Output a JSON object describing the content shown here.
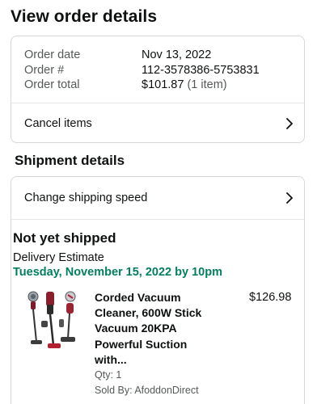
{
  "page": {
    "title": "View order details"
  },
  "summary": {
    "order_date_label": "Order date",
    "order_date_value": "Nov 13, 2022",
    "order_number_label": "Order #",
    "order_number_value": "112-3578386-5753831",
    "order_total_label": "Order total",
    "order_total_value": "$101.87",
    "order_total_items": "(1 item)",
    "cancel_label": "Cancel items"
  },
  "shipment": {
    "section_title": "Shipment details",
    "change_speed_label": "Change shipping speed",
    "status": "Not yet shipped",
    "estimate_label": "Delivery Estimate",
    "estimate_date": "Tuesday, November 15, 2022 by 10pm",
    "item": {
      "title": "Corded Vacuum Cleaner, 600W Stick Vacuum 20KPA Powerful Suction with...",
      "price": "$126.98",
      "qty": "Qty: 1",
      "seller": "Sold By: AfoddonDirect",
      "image_icon": "vacuum-product-image"
    }
  },
  "icons": {
    "chevron": "chevron-right-icon"
  },
  "colors": {
    "delivery_green": "#067d62",
    "muted_text": "#565959",
    "border": "#d5d9d9"
  }
}
